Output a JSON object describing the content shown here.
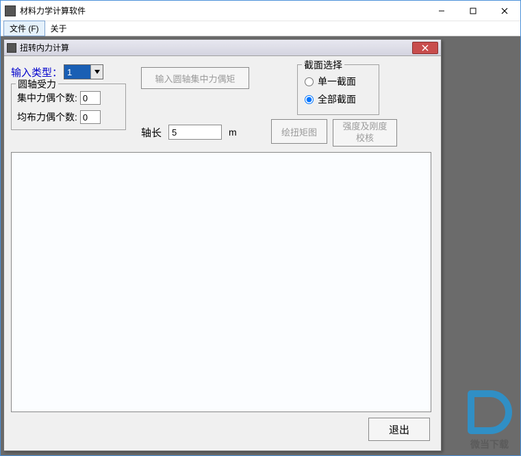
{
  "app": {
    "title": "材料力学计算软件"
  },
  "menu": {
    "file": "文件 (F)",
    "about": "关于"
  },
  "child": {
    "title": "扭转内力计算"
  },
  "inputType": {
    "label": "输入类型：",
    "value": "1"
  },
  "shaftForce": {
    "legend": "圆轴受力",
    "concentrated": {
      "label": "集中力偶个数:",
      "value": "0"
    },
    "distributed": {
      "label": "均布力偶个数:",
      "value": "0"
    }
  },
  "buttons": {
    "inputMoment": "输入圆轴集中力偶矩",
    "drawTorque": "绘扭矩图",
    "strengthCheck": "强度及刚度校核",
    "exit": "退出"
  },
  "section": {
    "legend": "截面选择",
    "single": "单一截面",
    "all": "全部截面",
    "selected": "all"
  },
  "axis": {
    "label": "轴长",
    "value": "5",
    "unit": "m"
  },
  "watermark": {
    "text": "微当下载"
  }
}
